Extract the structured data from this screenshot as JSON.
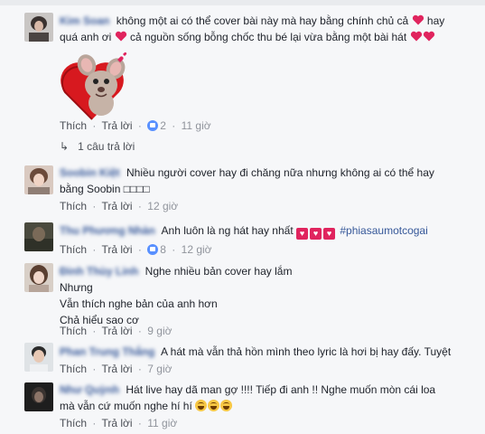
{
  "actions": {
    "like_label": "Thích",
    "reply_label": "Trả lời",
    "separator": "·"
  },
  "comments": [
    {
      "author": "Kim Soan",
      "line1": "không một ai có thể cover bài này mà hay bằng chính chủ cả",
      "line1b": "hay",
      "line2a": "quá anh ơi",
      "line2b": "cả nguồn sống bỗng chốc thu bé lại vừa bằng một bài hát",
      "likes": "2",
      "time": "11 giờ",
      "replies_label": "1 câu trả lời"
    },
    {
      "author": "Soobin Kiệt",
      "line1": "Nhiều người cover hay đi chăng nữa nhưng không ai có thể hay",
      "line2": "bằng Soobin □□□□",
      "time": "12 giờ"
    },
    {
      "author": "Thu Phương Nhàn",
      "text": "Anh luôn là ng hát hay nhất",
      "hashtag": "#phiasaumotcogai",
      "likes": "8",
      "time": "12 giờ"
    },
    {
      "author": "Đinh Thùy Linh",
      "line1": "Nghe nhiều bản cover hay lắm",
      "line2": "Nhưng",
      "line3": "Vẫn thích nghe bản của anh hơn",
      "line4": "Chả hiểu sao cơ",
      "time": "9 giờ"
    },
    {
      "author": "Phan Trung Thắng",
      "text": "A hát mà vẫn thả hồn mình theo lyric là hơi bị hay đấy. Tuyệt",
      "time": "7 giờ"
    },
    {
      "author": "Như Quỳnh",
      "line1": "Hát live hay dã man gợ !!!! Tiếp đi anh !! Nghe muốn mòn cái loa",
      "line2": "mà vẫn cứ muốn nghe hí hí",
      "time": "11 giờ"
    }
  ],
  "colors": {
    "link_blue": "#365899",
    "meta_gray": "#90949c",
    "heart_red": "#e0245e",
    "like_blue": "#5890ff"
  }
}
